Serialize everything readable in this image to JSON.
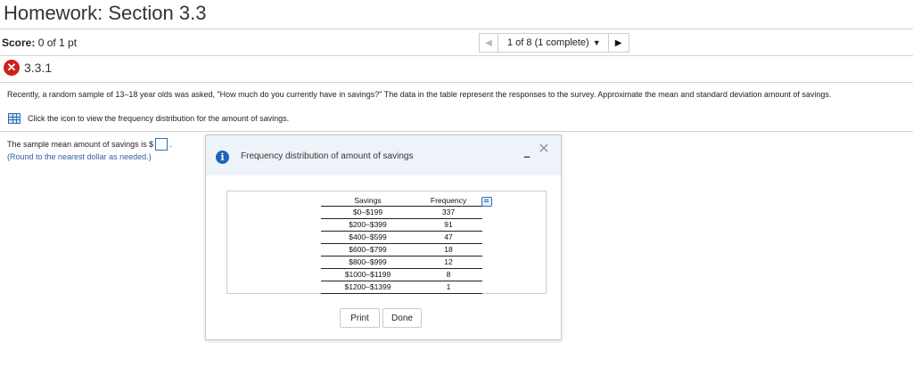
{
  "header": {
    "title": "Homework: Section 3.3"
  },
  "score": {
    "label": "Score:",
    "value": "0 of 1 pt"
  },
  "nav": {
    "prev_icon": "triangle-left-icon",
    "position": "1 of 8 (1 complete)",
    "dropdown_icon": "triangle-down-icon",
    "next_icon": "triangle-right-icon"
  },
  "question": {
    "status_icon": "x-circle-icon",
    "status_color": "#d0201a",
    "number": "3.3.1",
    "text": "Recently, a random sample of 13–18 year olds was asked, \"How much do you currently have in savings?\" The data in the table represent the responses to the survey. Approximate the mean and standard deviation amount of savings.",
    "table_link": "Click the icon to view the frequency distribution for the amount of savings.",
    "answer_prompt": "The sample mean amount of savings is $",
    "answer_value": "",
    "hint": "(Round to the nearest dollar as needed.)"
  },
  "modal": {
    "title": "Frequency distribution of amount of savings",
    "header_bg": "#eef3fa",
    "accent": "#1f63b8",
    "columns": [
      "Savings",
      "Frequency"
    ],
    "rows": [
      {
        "savings": "$0–$199",
        "frequency": "337"
      },
      {
        "savings": "$200–$399",
        "frequency": "91"
      },
      {
        "savings": "$400–$599",
        "frequency": "47"
      },
      {
        "savings": "$600–$799",
        "frequency": "18"
      },
      {
        "savings": "$800–$999",
        "frequency": "12"
      },
      {
        "savings": "$1000–$1199",
        "frequency": "8"
      },
      {
        "savings": "$1200–$1399",
        "frequency": "1"
      }
    ],
    "print_label": "Print",
    "done_label": "Done"
  }
}
